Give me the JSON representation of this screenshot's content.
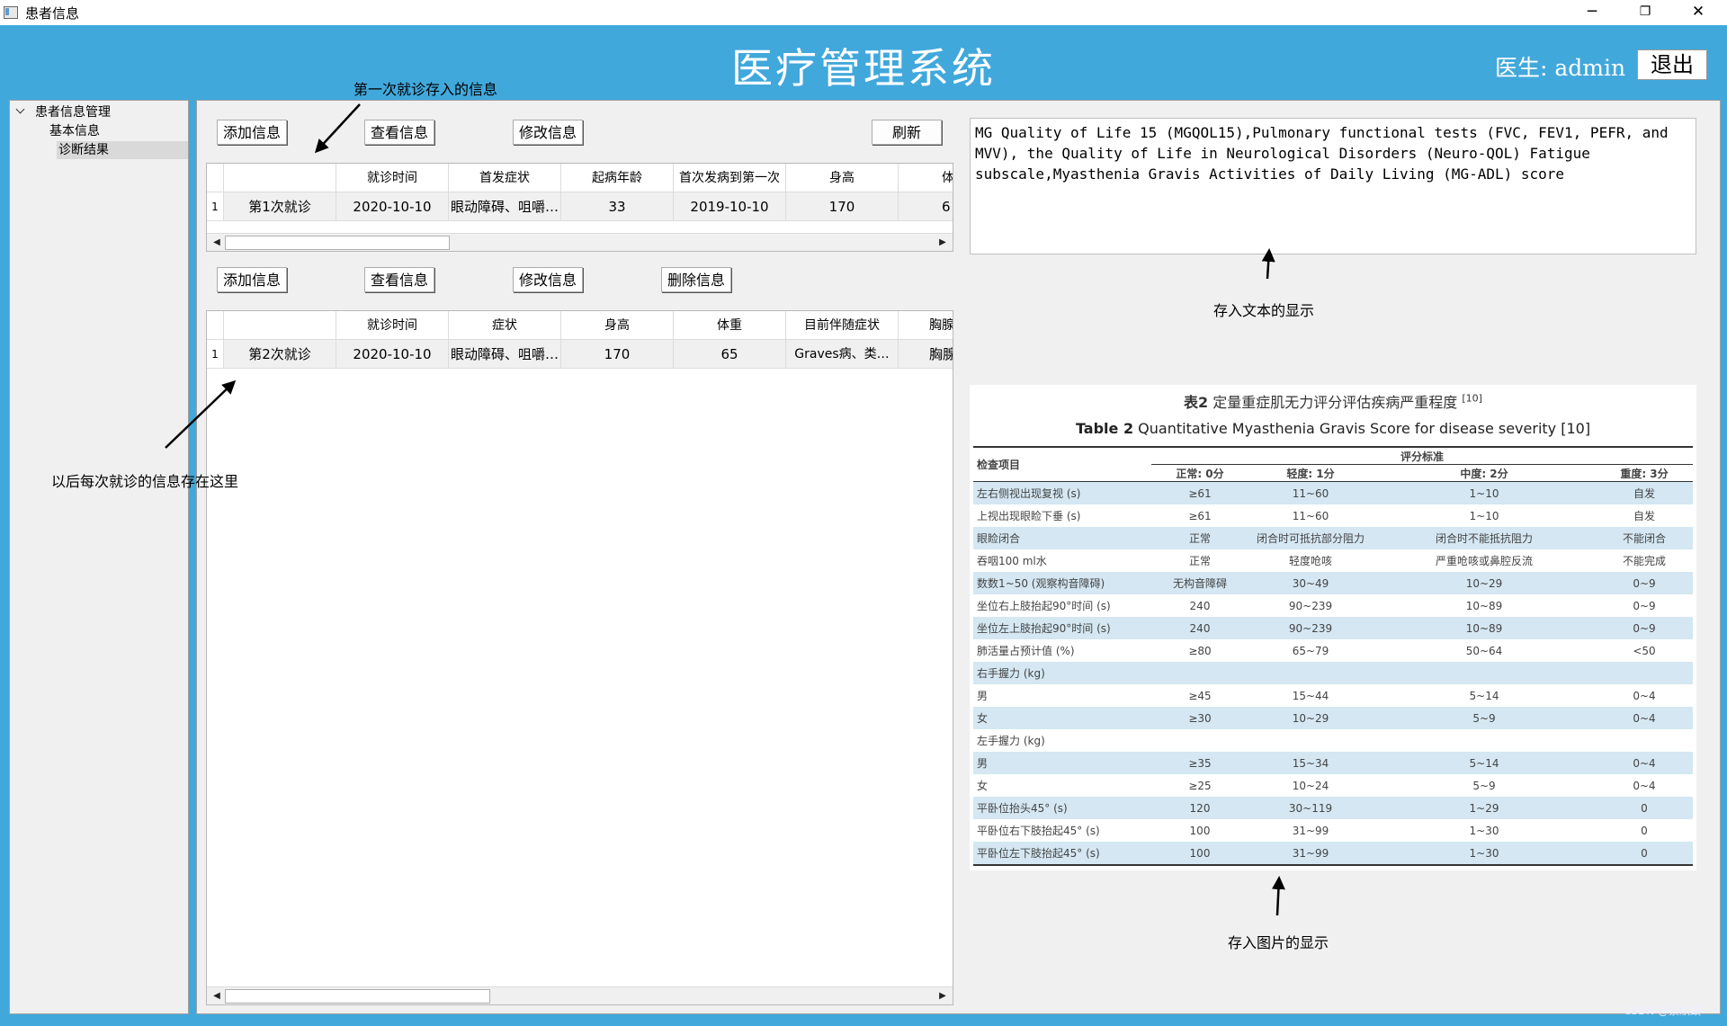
{
  "window": {
    "title": "患者信息",
    "minimize": "─",
    "restore": "❐",
    "close": "✕"
  },
  "header": {
    "title": "医疗管理系统",
    "doctor": "医生: admin",
    "logout": "退出"
  },
  "sidebar": {
    "root": "患者信息管理",
    "items": [
      "基本信息",
      "诊断结果"
    ]
  },
  "section1": {
    "buttons": [
      "添加信息",
      "查看信息",
      "修改信息",
      "刷新"
    ],
    "columns": [
      "",
      "就诊时间",
      "首发症状",
      "起病年龄",
      "首次发病到第一次",
      "身高",
      "体"
    ],
    "rows": [
      {
        "index": "1",
        "cells": [
          "第1次就诊",
          "2020-10-10",
          "眼动障碍、咀嚼…",
          "33",
          "2019-10-10",
          "170",
          "6"
        ]
      }
    ]
  },
  "section2": {
    "buttons": [
      "添加信息",
      "查看信息",
      "修改信息",
      "删除信息"
    ],
    "columns": [
      "",
      "就诊时间",
      "症状",
      "身高",
      "体重",
      "目前伴随症状",
      "胸腺"
    ],
    "rows": [
      {
        "index": "1",
        "cells": [
          "第2次就诊",
          "2020-10-10",
          "眼动障碍、咀嚼…",
          "170",
          "65",
          "Graves病、类…",
          "胸腺"
        ]
      }
    ]
  },
  "scroll": {
    "left": "◀",
    "right": "▶"
  },
  "annotations": {
    "first_visit": "第一次就诊存入的信息",
    "later_visits": "以后每次就诊的信息存在这里",
    "text_display": "存入文本的显示",
    "image_display": "存入图片的显示"
  },
  "text_content": "MG Quality of Life 15 (MGQOL15),Pulmonary functional tests (FVC, FEV1, PEFR, and MVV), the Quality of Life in Neurological Disorders (Neuro-QOL) Fatigue subscale,Myasthenia Gravis Activities of Daily Living (MG-ADL) score",
  "image_table": {
    "title_cn_bold": "表2",
    "title_cn": "定量重症肌无力评分评估疾病严重程度",
    "title_ref": "[10]",
    "title_en_bold": "Table 2",
    "title_en": "Quantitative Myasthenia Gravis Score for disease severity  [10]",
    "header_item": "检查项目",
    "header_group": "评分标准",
    "subheaders": [
      "正常: 0分",
      "轻度: 1分",
      "中度: 2分",
      "重度: 3分"
    ],
    "rows": [
      [
        "左右侧视出现复视 (s)",
        "≥61",
        "11~60",
        "1~10",
        "自发"
      ],
      [
        "上视出现眼睑下垂 (s)",
        "≥61",
        "11~60",
        "1~10",
        "自发"
      ],
      [
        "眼睑闭合",
        "正常",
        "闭合时可抵抗部分阻力",
        "闭合时不能抵抗阻力",
        "不能闭合"
      ],
      [
        "吞咽100 ml水",
        "正常",
        "轻度呛咳",
        "严重呛咳或鼻腔反流",
        "不能完成"
      ],
      [
        "数数1~50 (观察构音障碍)",
        "无构音障碍",
        "30~49",
        "10~29",
        "0~9"
      ],
      [
        "坐位右上肢抬起90°时间 (s)",
        "240",
        "90~239",
        "10~89",
        "0~9"
      ],
      [
        "坐位左上肢抬起90°时间 (s)",
        "240",
        "90~239",
        "10~89",
        "0~9"
      ],
      [
        "肺活量占预计值 (%)",
        "≥80",
        "65~79",
        "50~64",
        "<50"
      ],
      [
        "右手握力 (kg)",
        "",
        "",
        "",
        ""
      ],
      [
        "男",
        "≥45",
        "15~44",
        "5~14",
        "0~4"
      ],
      [
        "女",
        "≥30",
        "10~29",
        "5~9",
        "0~4"
      ],
      [
        "左手握力 (kg)",
        "",
        "",
        "",
        ""
      ],
      [
        "男",
        "≥35",
        "15~34",
        "5~14",
        "0~4"
      ],
      [
        "女",
        "≥25",
        "10~24",
        "5~9",
        "0~4"
      ],
      [
        "平卧位抬头45° (s)",
        "120",
        "30~119",
        "1~29",
        "0"
      ],
      [
        "平卧位右下肢抬起45° (s)",
        "100",
        "31~99",
        "1~30",
        "0"
      ],
      [
        "平卧位左下肢抬起45° (s)",
        "100",
        "31~99",
        "1~30",
        "0"
      ]
    ]
  },
  "watermark": "CSDN @蔡欣致"
}
